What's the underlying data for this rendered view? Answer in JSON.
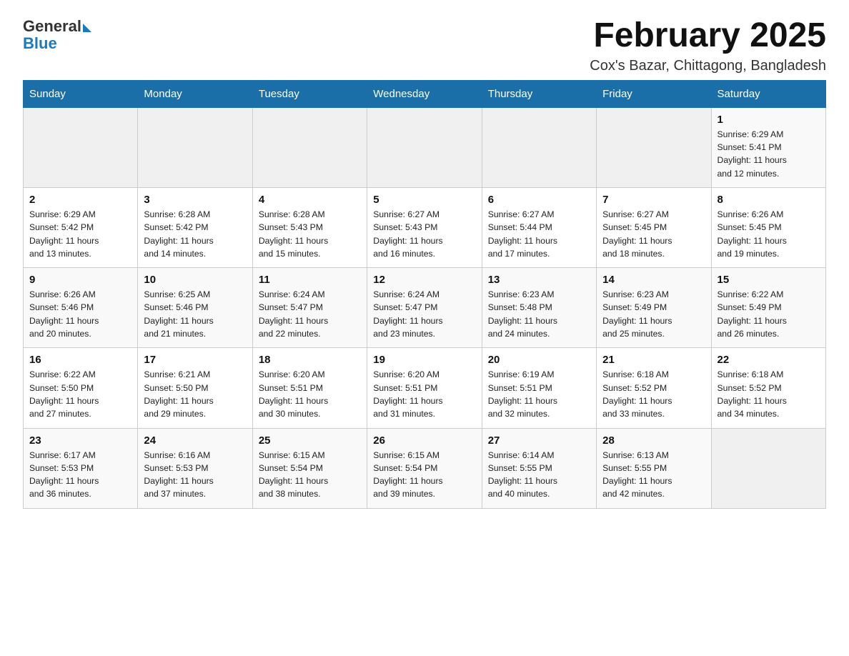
{
  "header": {
    "logo_general": "General",
    "logo_blue": "Blue",
    "month_title": "February 2025",
    "location": "Cox's Bazar, Chittagong, Bangladesh"
  },
  "weekdays": [
    "Sunday",
    "Monday",
    "Tuesday",
    "Wednesday",
    "Thursday",
    "Friday",
    "Saturday"
  ],
  "weeks": [
    [
      {
        "day": "",
        "info": ""
      },
      {
        "day": "",
        "info": ""
      },
      {
        "day": "",
        "info": ""
      },
      {
        "day": "",
        "info": ""
      },
      {
        "day": "",
        "info": ""
      },
      {
        "day": "",
        "info": ""
      },
      {
        "day": "1",
        "info": "Sunrise: 6:29 AM\nSunset: 5:41 PM\nDaylight: 11 hours\nand 12 minutes."
      }
    ],
    [
      {
        "day": "2",
        "info": "Sunrise: 6:29 AM\nSunset: 5:42 PM\nDaylight: 11 hours\nand 13 minutes."
      },
      {
        "day": "3",
        "info": "Sunrise: 6:28 AM\nSunset: 5:42 PM\nDaylight: 11 hours\nand 14 minutes."
      },
      {
        "day": "4",
        "info": "Sunrise: 6:28 AM\nSunset: 5:43 PM\nDaylight: 11 hours\nand 15 minutes."
      },
      {
        "day": "5",
        "info": "Sunrise: 6:27 AM\nSunset: 5:43 PM\nDaylight: 11 hours\nand 16 minutes."
      },
      {
        "day": "6",
        "info": "Sunrise: 6:27 AM\nSunset: 5:44 PM\nDaylight: 11 hours\nand 17 minutes."
      },
      {
        "day": "7",
        "info": "Sunrise: 6:27 AM\nSunset: 5:45 PM\nDaylight: 11 hours\nand 18 minutes."
      },
      {
        "day": "8",
        "info": "Sunrise: 6:26 AM\nSunset: 5:45 PM\nDaylight: 11 hours\nand 19 minutes."
      }
    ],
    [
      {
        "day": "9",
        "info": "Sunrise: 6:26 AM\nSunset: 5:46 PM\nDaylight: 11 hours\nand 20 minutes."
      },
      {
        "day": "10",
        "info": "Sunrise: 6:25 AM\nSunset: 5:46 PM\nDaylight: 11 hours\nand 21 minutes."
      },
      {
        "day": "11",
        "info": "Sunrise: 6:24 AM\nSunset: 5:47 PM\nDaylight: 11 hours\nand 22 minutes."
      },
      {
        "day": "12",
        "info": "Sunrise: 6:24 AM\nSunset: 5:47 PM\nDaylight: 11 hours\nand 23 minutes."
      },
      {
        "day": "13",
        "info": "Sunrise: 6:23 AM\nSunset: 5:48 PM\nDaylight: 11 hours\nand 24 minutes."
      },
      {
        "day": "14",
        "info": "Sunrise: 6:23 AM\nSunset: 5:49 PM\nDaylight: 11 hours\nand 25 minutes."
      },
      {
        "day": "15",
        "info": "Sunrise: 6:22 AM\nSunset: 5:49 PM\nDaylight: 11 hours\nand 26 minutes."
      }
    ],
    [
      {
        "day": "16",
        "info": "Sunrise: 6:22 AM\nSunset: 5:50 PM\nDaylight: 11 hours\nand 27 minutes."
      },
      {
        "day": "17",
        "info": "Sunrise: 6:21 AM\nSunset: 5:50 PM\nDaylight: 11 hours\nand 29 minutes."
      },
      {
        "day": "18",
        "info": "Sunrise: 6:20 AM\nSunset: 5:51 PM\nDaylight: 11 hours\nand 30 minutes."
      },
      {
        "day": "19",
        "info": "Sunrise: 6:20 AM\nSunset: 5:51 PM\nDaylight: 11 hours\nand 31 minutes."
      },
      {
        "day": "20",
        "info": "Sunrise: 6:19 AM\nSunset: 5:51 PM\nDaylight: 11 hours\nand 32 minutes."
      },
      {
        "day": "21",
        "info": "Sunrise: 6:18 AM\nSunset: 5:52 PM\nDaylight: 11 hours\nand 33 minutes."
      },
      {
        "day": "22",
        "info": "Sunrise: 6:18 AM\nSunset: 5:52 PM\nDaylight: 11 hours\nand 34 minutes."
      }
    ],
    [
      {
        "day": "23",
        "info": "Sunrise: 6:17 AM\nSunset: 5:53 PM\nDaylight: 11 hours\nand 36 minutes."
      },
      {
        "day": "24",
        "info": "Sunrise: 6:16 AM\nSunset: 5:53 PM\nDaylight: 11 hours\nand 37 minutes."
      },
      {
        "day": "25",
        "info": "Sunrise: 6:15 AM\nSunset: 5:54 PM\nDaylight: 11 hours\nand 38 minutes."
      },
      {
        "day": "26",
        "info": "Sunrise: 6:15 AM\nSunset: 5:54 PM\nDaylight: 11 hours\nand 39 minutes."
      },
      {
        "day": "27",
        "info": "Sunrise: 6:14 AM\nSunset: 5:55 PM\nDaylight: 11 hours\nand 40 minutes."
      },
      {
        "day": "28",
        "info": "Sunrise: 6:13 AM\nSunset: 5:55 PM\nDaylight: 11 hours\nand 42 minutes."
      },
      {
        "day": "",
        "info": ""
      }
    ]
  ]
}
